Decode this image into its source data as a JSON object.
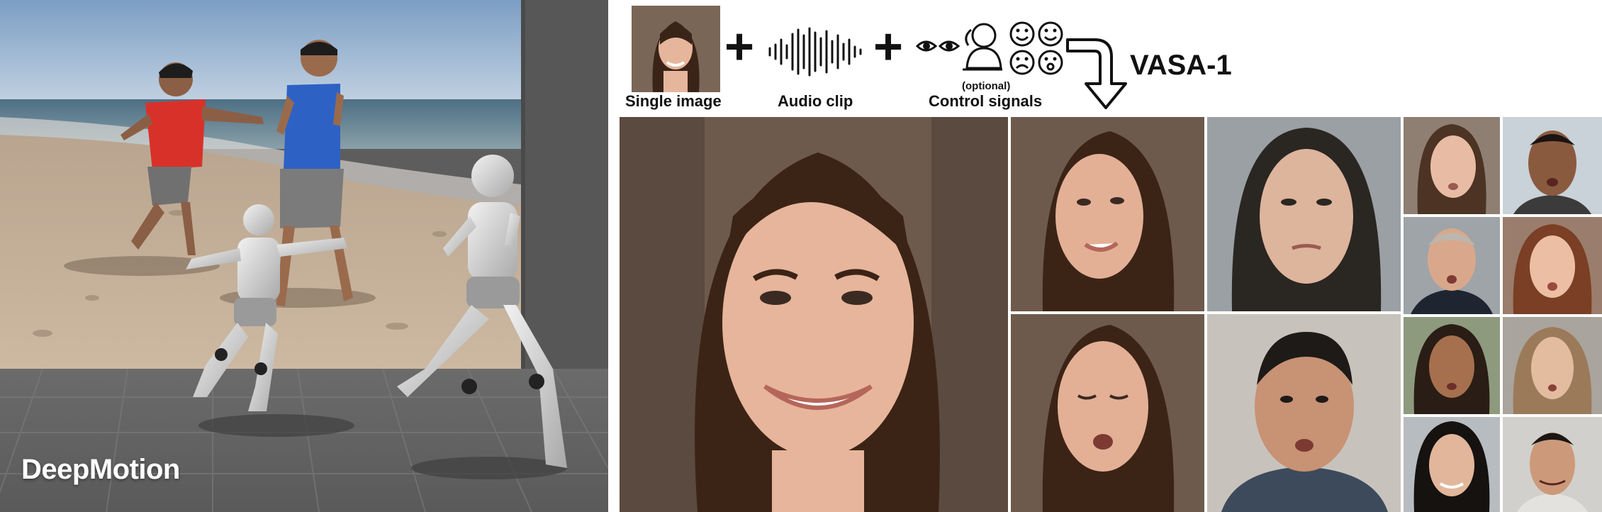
{
  "left": {
    "label": "DeepMotion"
  },
  "right": {
    "inputs": {
      "single_image_label": "Single image",
      "audio_clip_label": "Audio clip",
      "optional_label": "(optional)",
      "control_signals_label": "Control signals",
      "plus_symbol": "+"
    },
    "title": "VASA-1",
    "icons": [
      "portrait-thumbnail",
      "audio-waveform-icon",
      "eyes-icon",
      "person-icon",
      "emotion-faces-icon",
      "curved-arrow-icon"
    ]
  }
}
